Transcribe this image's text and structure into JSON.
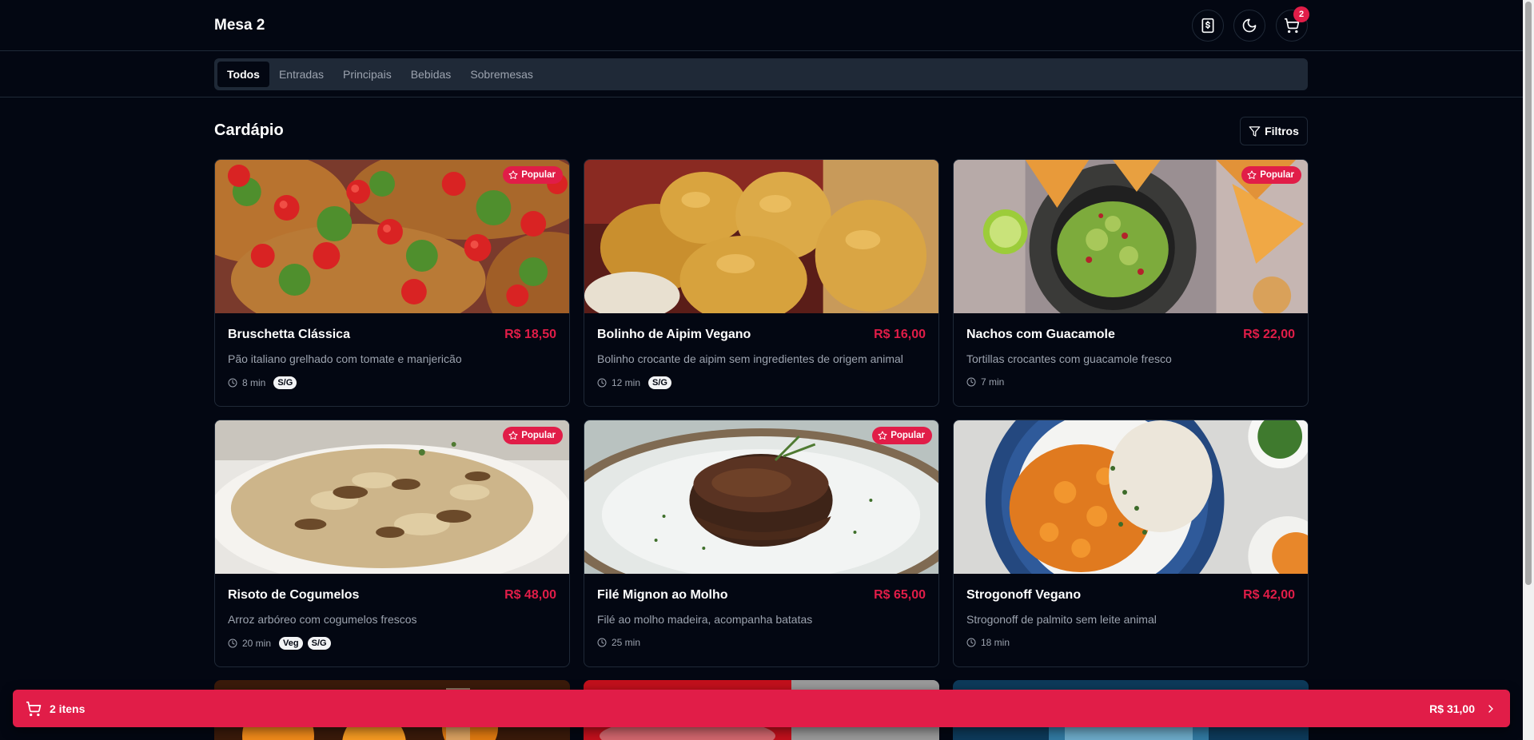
{
  "header": {
    "title": "Mesa 2",
    "cart_count": "2"
  },
  "tabs": [
    {
      "label": "Todos",
      "active": true
    },
    {
      "label": "Entradas",
      "active": false
    },
    {
      "label": "Principais",
      "active": false
    },
    {
      "label": "Bebidas",
      "active": false
    },
    {
      "label": "Sobremesas",
      "active": false
    }
  ],
  "menu": {
    "title": "Cardápio",
    "filter_label": "Filtros",
    "items": [
      {
        "name": "Bruschetta Clássica",
        "price": "R$ 18,50",
        "description": "Pão italiano grelhado com tomate e manjericão",
        "time": "8 min",
        "tags": [
          "S/G"
        ],
        "popular": "Popular"
      },
      {
        "name": "Bolinho de Aipim Vegano",
        "price": "R$ 16,00",
        "description": "Bolinho crocante de aipim sem ingredientes de origem animal",
        "time": "12 min",
        "tags": [
          "S/G"
        ],
        "popular": ""
      },
      {
        "name": "Nachos com Guacamole",
        "price": "R$ 22,00",
        "description": "Tortillas crocantes com guacamole fresco",
        "time": "7 min",
        "tags": [],
        "popular": "Popular"
      },
      {
        "name": "Risoto de Cogumelos",
        "price": "R$ 48,00",
        "description": "Arroz arbóreo com cogumelos frescos",
        "time": "20 min",
        "tags": [
          "Veg",
          "S/G"
        ],
        "popular": "Popular"
      },
      {
        "name": "Filé Mignon ao Molho",
        "price": "R$ 65,00",
        "description": "Filé ao molho madeira, acompanha batatas",
        "time": "25 min",
        "tags": [],
        "popular": "Popular"
      },
      {
        "name": "Strogonoff Vegano",
        "price": "R$ 42,00",
        "description": "Strogonoff de palmito sem leite animal",
        "time": "18 min",
        "tags": [],
        "popular": ""
      }
    ]
  },
  "cart_bar": {
    "items_label": "2 itens",
    "total": "R$ 31,00"
  },
  "colors": {
    "background": "#030712",
    "accent": "#e11d48",
    "border": "#1f2937",
    "muted_text": "#9ca3af"
  },
  "icons": [
    "bill-icon",
    "moon-icon",
    "cart-icon",
    "filter-icon",
    "star-icon",
    "clock-icon",
    "chevron-right-icon"
  ]
}
